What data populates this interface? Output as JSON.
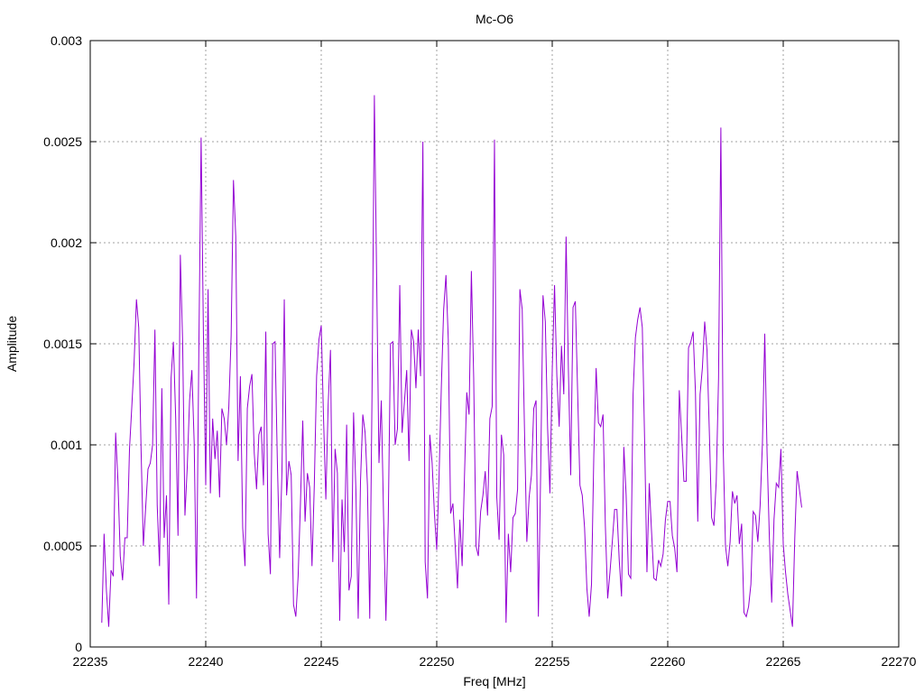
{
  "chart_data": {
    "type": "line",
    "title": "Mc-O6",
    "xlabel": "Freq [MHz]",
    "ylabel": "Amplitude",
    "xlim": [
      22235,
      22270
    ],
    "ylim": [
      0,
      0.003
    ],
    "x_ticks": [
      "22235",
      "22240",
      "22245",
      "22250",
      "22255",
      "22260",
      "22265",
      "22270"
    ],
    "y_ticks": [
      "0",
      "0.0005",
      "0.001",
      "0.0015",
      "0.002",
      "0.0025",
      "0.003"
    ],
    "grid": true,
    "series": [
      {
        "color": "#9400d3",
        "x_start": 22235.5,
        "x_step": 0.1,
        "values": [
          0.00012,
          0.00056,
          0.00028,
          0.0001,
          0.00038,
          0.00035,
          0.00106,
          0.00082,
          0.00045,
          0.00033,
          0.00054,
          0.00054,
          0.00098,
          0.00119,
          0.00141,
          0.00172,
          0.00158,
          0.00098,
          0.0005,
          0.00069,
          0.00088,
          0.00091,
          0.001,
          0.00157,
          0.0007,
          0.0004,
          0.00128,
          0.00054,
          0.00075,
          0.00021,
          0.00133,
          0.00151,
          0.00113,
          0.00055,
          0.00194,
          0.00151,
          0.00065,
          0.00089,
          0.00122,
          0.00137,
          0.00101,
          0.00024,
          0.00145,
          0.00252,
          0.00155,
          0.0008,
          0.00177,
          0.00076,
          0.00113,
          0.00093,
          0.00107,
          0.00074,
          0.00118,
          0.00113,
          0.001,
          0.00119,
          0.00154,
          0.00231,
          0.00203,
          0.00092,
          0.00134,
          0.00059,
          0.0004,
          0.00118,
          0.00129,
          0.00135,
          0.00096,
          0.00078,
          0.00105,
          0.00109,
          0.0008,
          0.00156,
          0.00056,
          0.00036,
          0.0015,
          0.00151,
          0.00092,
          0.00044,
          0.00087,
          0.00172,
          0.00075,
          0.00092,
          0.00085,
          0.00021,
          0.00015,
          0.00035,
          0.00071,
          0.00112,
          0.00062,
          0.00086,
          0.00079,
          0.0004,
          0.0008,
          0.00134,
          0.00152,
          0.00159,
          0.00113,
          0.00073,
          0.0012,
          0.00147,
          0.00042,
          0.00098,
          0.00086,
          0.00013,
          0.00073,
          0.00047,
          0.0011,
          0.00028,
          0.00035,
          0.00116,
          0.00078,
          0.00014,
          0.00082,
          0.00115,
          0.00106,
          0.0008,
          0.00014,
          0.00127,
          0.00273,
          0.00182,
          0.00091,
          0.00122,
          0.00064,
          0.00013,
          0.00062,
          0.0015,
          0.00151,
          0.001,
          0.00108,
          0.00179,
          0.00106,
          0.00121,
          0.00137,
          0.00092,
          0.00157,
          0.00151,
          0.00128,
          0.00157,
          0.00134,
          0.0025,
          0.00042,
          0.00024,
          0.00105,
          0.00091,
          0.00066,
          0.00048,
          0.00084,
          0.00129,
          0.00167,
          0.00184,
          0.00152,
          0.00066,
          0.00071,
          0.0005,
          0.00029,
          0.00063,
          0.0004,
          0.00084,
          0.00126,
          0.00115,
          0.00186,
          0.00133,
          0.0005,
          0.00045,
          0.00067,
          0.00075,
          0.00087,
          0.00065,
          0.00113,
          0.00119,
          0.00251,
          0.00074,
          0.00053,
          0.00105,
          0.00095,
          0.00012,
          0.00056,
          0.00037,
          0.00064,
          0.00066,
          0.00078,
          0.00177,
          0.00167,
          0.00107,
          0.00052,
          0.00074,
          0.00085,
          0.00118,
          0.00122,
          0.00015,
          0.00087,
          0.00174,
          0.00161,
          0.00108,
          0.00076,
          0.00137,
          0.00179,
          0.00134,
          0.00109,
          0.00149,
          0.00125,
          0.00203,
          0.00137,
          0.00085,
          0.00168,
          0.00171,
          0.00126,
          0.0008,
          0.00075,
          0.00059,
          0.00029,
          0.00015,
          0.00031,
          0.00095,
          0.00138,
          0.00111,
          0.00109,
          0.00115,
          0.0006,
          0.00024,
          0.00037,
          0.00052,
          0.00068,
          0.00068,
          0.00043,
          0.00025,
          0.00099,
          0.00075,
          0.00036,
          0.00034,
          0.00125,
          0.00153,
          0.00162,
          0.00168,
          0.00158,
          0.00102,
          0.00037,
          0.00081,
          0.00057,
          0.00034,
          0.00033,
          0.00043,
          0.0004,
          0.00046,
          0.00063,
          0.00072,
          0.00072,
          0.00055,
          0.00049,
          0.00037,
          0.00127,
          0.00105,
          0.00082,
          0.00082,
          0.00148,
          0.00151,
          0.00156,
          0.00126,
          0.00062,
          0.00125,
          0.00138,
          0.00161,
          0.00147,
          0.00107,
          0.00064,
          0.0006,
          0.00082,
          0.00133,
          0.00257,
          0.00099,
          0.0005,
          0.0004,
          0.00052,
          0.00077,
          0.00071,
          0.00075,
          0.00051,
          0.00061,
          0.00017,
          0.00015,
          0.0002,
          0.00031,
          0.00067,
          0.00065,
          0.00052,
          0.0007,
          0.00101,
          0.00155,
          0.00096,
          0.00054,
          0.00022,
          0.00063,
          0.00081,
          0.00079,
          0.00098,
          0.00051,
          0.00037,
          0.00026,
          0.00018,
          0.0001,
          0.00054,
          0.00087,
          0.00078,
          0.00069
        ]
      }
    ]
  }
}
